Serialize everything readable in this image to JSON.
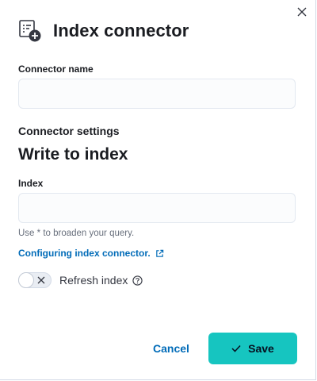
{
  "flyout": {
    "title": "Index connector",
    "icons": {
      "header": "connector-add-icon",
      "close": "close-icon"
    }
  },
  "form": {
    "connector_name": {
      "label": "Connector name",
      "value": "",
      "placeholder": ""
    },
    "settings_heading": "Connector settings",
    "section_title": "Write to index",
    "index": {
      "label": "Index",
      "value": "",
      "placeholder": "",
      "help_text": "Use * to broaden your query."
    },
    "docs_link": {
      "label": "Configuring index connector.",
      "icon": "external-link-icon"
    },
    "refresh_index": {
      "label": "Refresh index",
      "checked": false,
      "icon": "question-circle-icon"
    }
  },
  "footer": {
    "cancel_label": "Cancel",
    "save_label": "Save",
    "save_icon": "check-icon"
  },
  "colors": {
    "accent": "#16c5c0",
    "link": "#006bb8"
  }
}
